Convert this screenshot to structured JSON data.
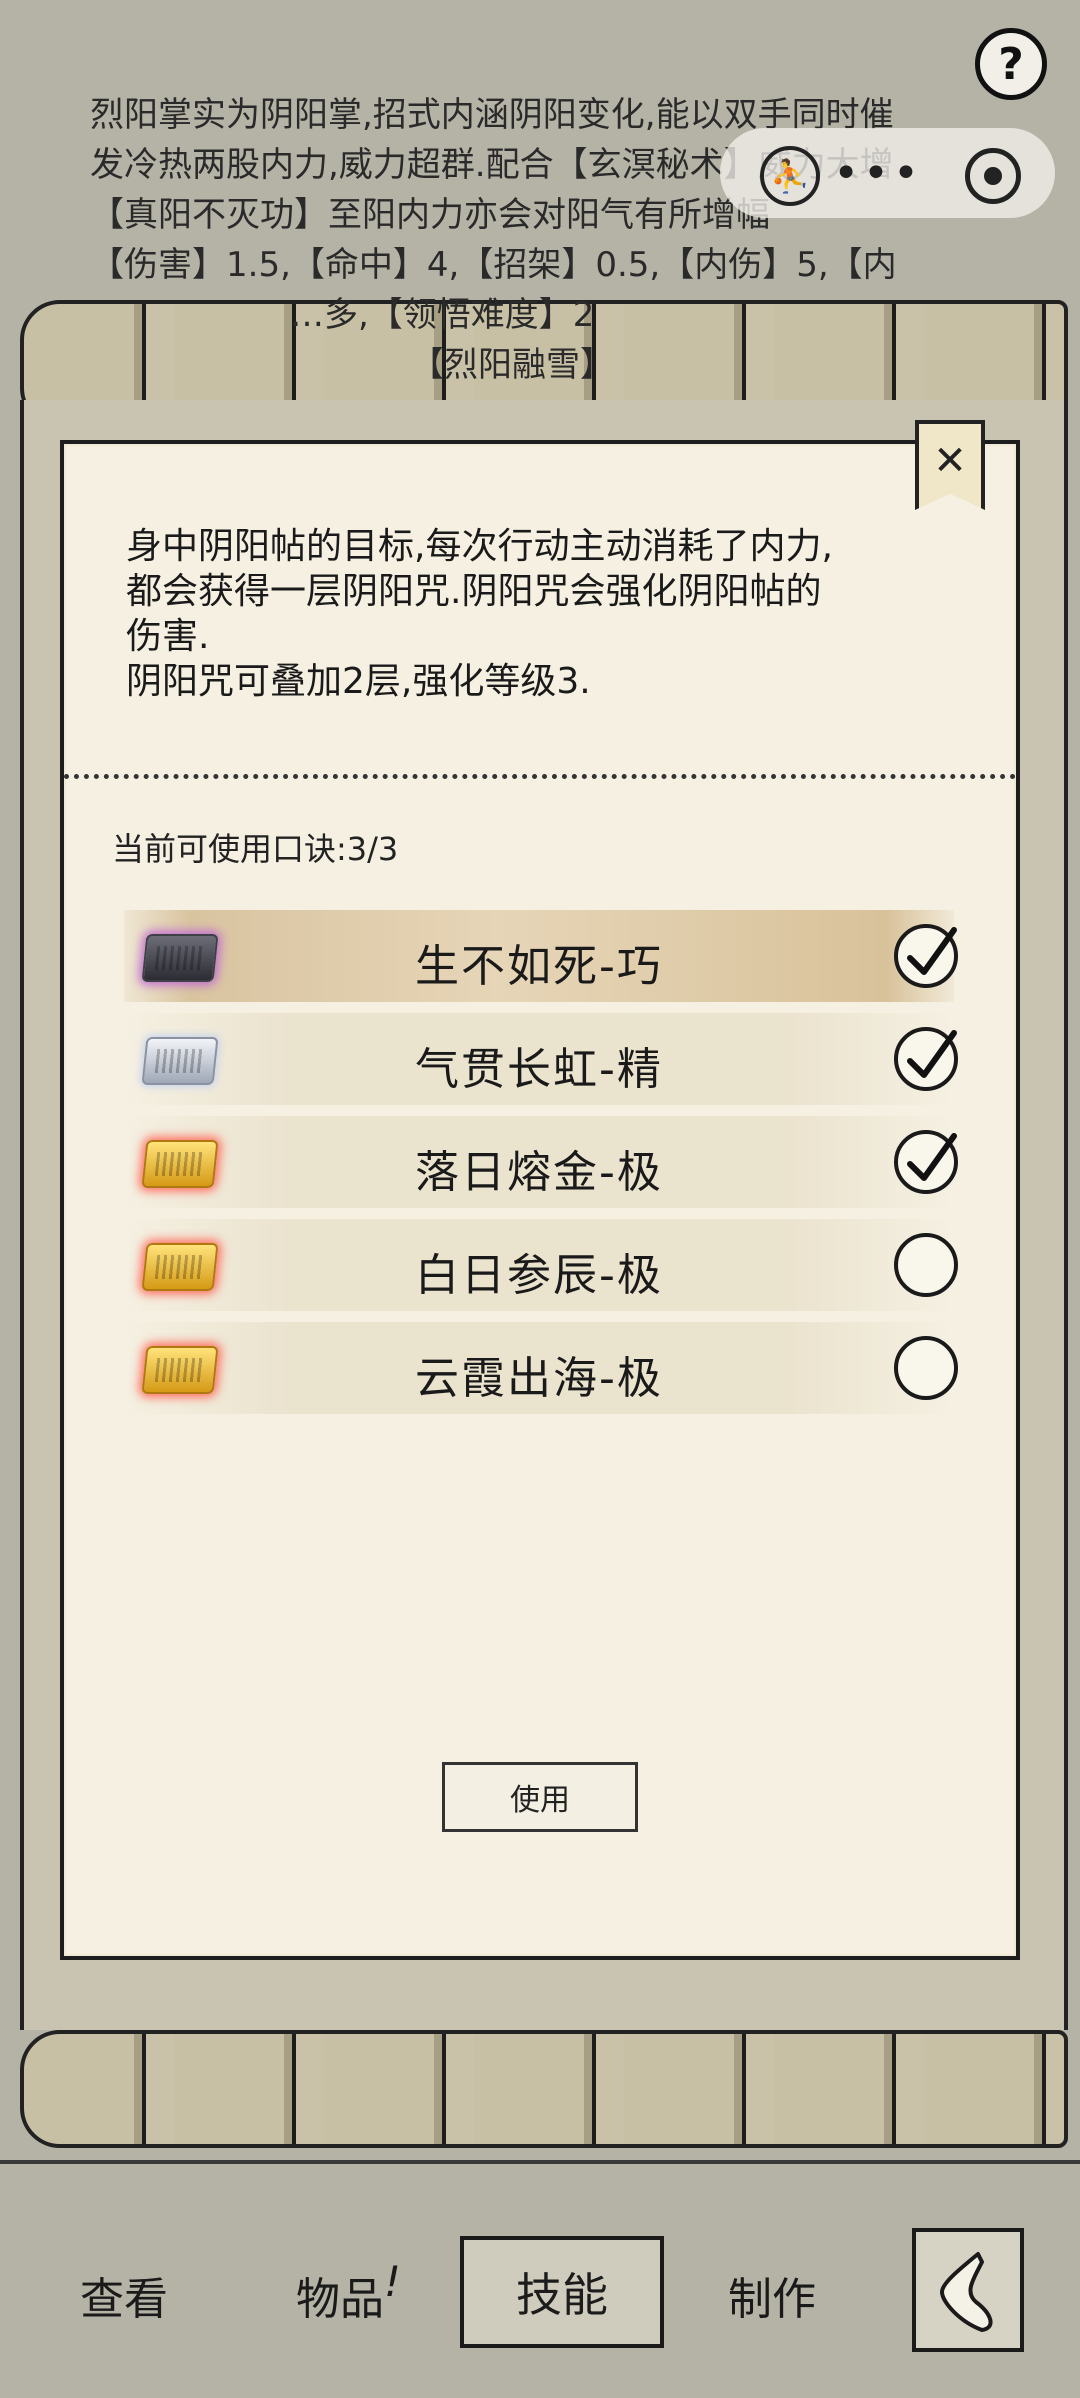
{
  "background": {
    "lines": [
      "烈阳掌实为阴阳掌,招式内涵阴阳变化,能以双手同时催",
      "发冷热两股内力,威力超群.配合【玄溟秘术】威力大增",
      "【真阳不灭功】至阳内力亦会对阳气有所增幅",
      "【伤害】1.5,【命中】4,【招架】0.5,【内伤】5,【内",
      "…多,【领悟难度】2",
      "【烈阳融雪】"
    ]
  },
  "help": {
    "label": "?"
  },
  "overlay": {
    "dots": "•••"
  },
  "dialog": {
    "close_label": "✕",
    "description": [
      "身中阴阳帖的目标,每次行动主动消耗了内力,",
      "都会获得一层阴阳咒.阴阳咒会强化阴阳帖的",
      "伤害.",
      "阴阳咒可叠加2层,强化等级3."
    ],
    "count_label": "当前可使用口诀:3/3",
    "skills": [
      {
        "name": "生不如死-巧",
        "tier": "purple",
        "checked": true
      },
      {
        "name": "气贯长虹-精",
        "tier": "silver",
        "checked": true
      },
      {
        "name": "落日熔金-极",
        "tier": "gold",
        "checked": true
      },
      {
        "name": "白日参辰-极",
        "tier": "gold",
        "checked": false
      },
      {
        "name": "云霞出海-极",
        "tier": "gold",
        "checked": false
      }
    ],
    "use_label": "使用"
  },
  "nav": {
    "view": "查看",
    "items": "物品",
    "items_badge": "!",
    "skills": "技能",
    "craft": "制作"
  },
  "colors": {
    "paper": "#f5f0e2",
    "background": "#b5b2a6",
    "purple_glow": "#c06bd2",
    "gold_glow": "#ff6a5a"
  }
}
